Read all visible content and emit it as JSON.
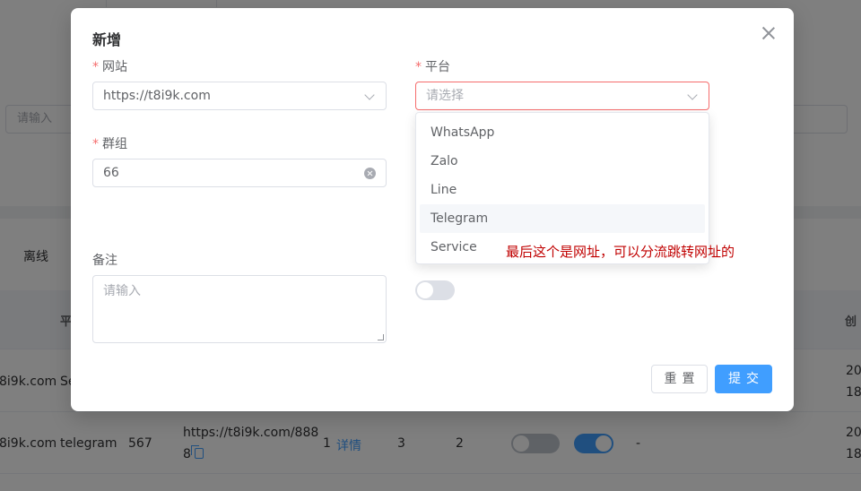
{
  "background": {
    "search_placeholder": "请输入",
    "status_tab": "离线",
    "table_headers": [
      "平",
      "创"
    ],
    "rows": [
      {
        "site": "8i9k.com",
        "platform": "Se",
        "created": [
          "20",
          "18"
        ]
      },
      {
        "site": "8i9k.com",
        "platform": "telegram",
        "count": "567",
        "url_line1": "https://t8i9k.com/888",
        "url_line2": "8",
        "groups_count": "1",
        "detail": "详情",
        "col_a": "3",
        "col_b": "2",
        "note": "-",
        "created": [
          "20",
          "18"
        ]
      }
    ]
  },
  "dialog": {
    "title": "新增",
    "fields": {
      "site": {
        "label": "网站",
        "required_mark": "*",
        "value": "https://t8i9k.com"
      },
      "platform": {
        "label": "平台",
        "required_mark": "*",
        "placeholder": "请选择"
      },
      "group": {
        "label": "群组",
        "required_mark": "*",
        "value": "66"
      },
      "remark": {
        "label": "备注",
        "placeholder": "请输入"
      }
    },
    "platform_options": [
      "WhatsApp",
      "Zalo",
      "Line",
      "Telegram",
      "Service"
    ],
    "highlighted_option": "Telegram",
    "reset_label": "重置",
    "submit_label": "提交"
  },
  "annotation": "最后这个是网址，可以分流跳转网址的",
  "colors": {
    "primary": "#409eff",
    "danger": "#f56c6c",
    "annotation": "#c00000",
    "overlay": "rgba(0,0,0,0.5)"
  }
}
